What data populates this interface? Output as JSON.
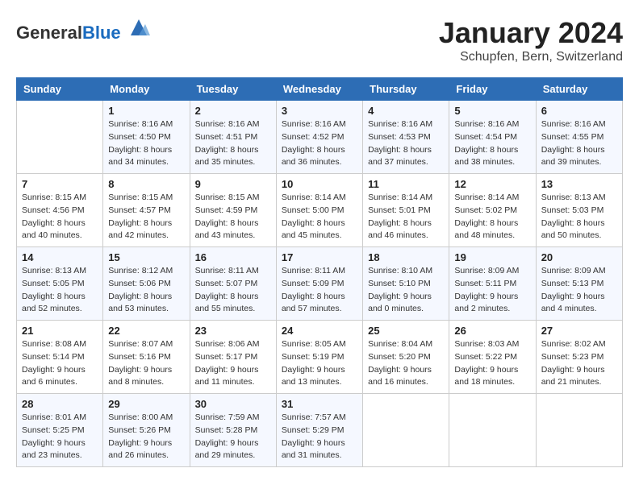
{
  "header": {
    "logo_general": "General",
    "logo_blue": "Blue",
    "month_title": "January 2024",
    "location": "Schupfen, Bern, Switzerland"
  },
  "days_of_week": [
    "Sunday",
    "Monday",
    "Tuesday",
    "Wednesday",
    "Thursday",
    "Friday",
    "Saturday"
  ],
  "weeks": [
    [
      {
        "day": "",
        "sunrise": "",
        "sunset": "",
        "daylight": ""
      },
      {
        "day": "1",
        "sunrise": "Sunrise: 8:16 AM",
        "sunset": "Sunset: 4:50 PM",
        "daylight": "Daylight: 8 hours and 34 minutes."
      },
      {
        "day": "2",
        "sunrise": "Sunrise: 8:16 AM",
        "sunset": "Sunset: 4:51 PM",
        "daylight": "Daylight: 8 hours and 35 minutes."
      },
      {
        "day": "3",
        "sunrise": "Sunrise: 8:16 AM",
        "sunset": "Sunset: 4:52 PM",
        "daylight": "Daylight: 8 hours and 36 minutes."
      },
      {
        "day": "4",
        "sunrise": "Sunrise: 8:16 AM",
        "sunset": "Sunset: 4:53 PM",
        "daylight": "Daylight: 8 hours and 37 minutes."
      },
      {
        "day": "5",
        "sunrise": "Sunrise: 8:16 AM",
        "sunset": "Sunset: 4:54 PM",
        "daylight": "Daylight: 8 hours and 38 minutes."
      },
      {
        "day": "6",
        "sunrise": "Sunrise: 8:16 AM",
        "sunset": "Sunset: 4:55 PM",
        "daylight": "Daylight: 8 hours and 39 minutes."
      }
    ],
    [
      {
        "day": "7",
        "sunrise": "Sunrise: 8:15 AM",
        "sunset": "Sunset: 4:56 PM",
        "daylight": "Daylight: 8 hours and 40 minutes."
      },
      {
        "day": "8",
        "sunrise": "Sunrise: 8:15 AM",
        "sunset": "Sunset: 4:57 PM",
        "daylight": "Daylight: 8 hours and 42 minutes."
      },
      {
        "day": "9",
        "sunrise": "Sunrise: 8:15 AM",
        "sunset": "Sunset: 4:59 PM",
        "daylight": "Daylight: 8 hours and 43 minutes."
      },
      {
        "day": "10",
        "sunrise": "Sunrise: 8:14 AM",
        "sunset": "Sunset: 5:00 PM",
        "daylight": "Daylight: 8 hours and 45 minutes."
      },
      {
        "day": "11",
        "sunrise": "Sunrise: 8:14 AM",
        "sunset": "Sunset: 5:01 PM",
        "daylight": "Daylight: 8 hours and 46 minutes."
      },
      {
        "day": "12",
        "sunrise": "Sunrise: 8:14 AM",
        "sunset": "Sunset: 5:02 PM",
        "daylight": "Daylight: 8 hours and 48 minutes."
      },
      {
        "day": "13",
        "sunrise": "Sunrise: 8:13 AM",
        "sunset": "Sunset: 5:03 PM",
        "daylight": "Daylight: 8 hours and 50 minutes."
      }
    ],
    [
      {
        "day": "14",
        "sunrise": "Sunrise: 8:13 AM",
        "sunset": "Sunset: 5:05 PM",
        "daylight": "Daylight: 8 hours and 52 minutes."
      },
      {
        "day": "15",
        "sunrise": "Sunrise: 8:12 AM",
        "sunset": "Sunset: 5:06 PM",
        "daylight": "Daylight: 8 hours and 53 minutes."
      },
      {
        "day": "16",
        "sunrise": "Sunrise: 8:11 AM",
        "sunset": "Sunset: 5:07 PM",
        "daylight": "Daylight: 8 hours and 55 minutes."
      },
      {
        "day": "17",
        "sunrise": "Sunrise: 8:11 AM",
        "sunset": "Sunset: 5:09 PM",
        "daylight": "Daylight: 8 hours and 57 minutes."
      },
      {
        "day": "18",
        "sunrise": "Sunrise: 8:10 AM",
        "sunset": "Sunset: 5:10 PM",
        "daylight": "Daylight: 9 hours and 0 minutes."
      },
      {
        "day": "19",
        "sunrise": "Sunrise: 8:09 AM",
        "sunset": "Sunset: 5:11 PM",
        "daylight": "Daylight: 9 hours and 2 minutes."
      },
      {
        "day": "20",
        "sunrise": "Sunrise: 8:09 AM",
        "sunset": "Sunset: 5:13 PM",
        "daylight": "Daylight: 9 hours and 4 minutes."
      }
    ],
    [
      {
        "day": "21",
        "sunrise": "Sunrise: 8:08 AM",
        "sunset": "Sunset: 5:14 PM",
        "daylight": "Daylight: 9 hours and 6 minutes."
      },
      {
        "day": "22",
        "sunrise": "Sunrise: 8:07 AM",
        "sunset": "Sunset: 5:16 PM",
        "daylight": "Daylight: 9 hours and 8 minutes."
      },
      {
        "day": "23",
        "sunrise": "Sunrise: 8:06 AM",
        "sunset": "Sunset: 5:17 PM",
        "daylight": "Daylight: 9 hours and 11 minutes."
      },
      {
        "day": "24",
        "sunrise": "Sunrise: 8:05 AM",
        "sunset": "Sunset: 5:19 PM",
        "daylight": "Daylight: 9 hours and 13 minutes."
      },
      {
        "day": "25",
        "sunrise": "Sunrise: 8:04 AM",
        "sunset": "Sunset: 5:20 PM",
        "daylight": "Daylight: 9 hours and 16 minutes."
      },
      {
        "day": "26",
        "sunrise": "Sunrise: 8:03 AM",
        "sunset": "Sunset: 5:22 PM",
        "daylight": "Daylight: 9 hours and 18 minutes."
      },
      {
        "day": "27",
        "sunrise": "Sunrise: 8:02 AM",
        "sunset": "Sunset: 5:23 PM",
        "daylight": "Daylight: 9 hours and 21 minutes."
      }
    ],
    [
      {
        "day": "28",
        "sunrise": "Sunrise: 8:01 AM",
        "sunset": "Sunset: 5:25 PM",
        "daylight": "Daylight: 9 hours and 23 minutes."
      },
      {
        "day": "29",
        "sunrise": "Sunrise: 8:00 AM",
        "sunset": "Sunset: 5:26 PM",
        "daylight": "Daylight: 9 hours and 26 minutes."
      },
      {
        "day": "30",
        "sunrise": "Sunrise: 7:59 AM",
        "sunset": "Sunset: 5:28 PM",
        "daylight": "Daylight: 9 hours and 29 minutes."
      },
      {
        "day": "31",
        "sunrise": "Sunrise: 7:57 AM",
        "sunset": "Sunset: 5:29 PM",
        "daylight": "Daylight: 9 hours and 31 minutes."
      },
      {
        "day": "",
        "sunrise": "",
        "sunset": "",
        "daylight": ""
      },
      {
        "day": "",
        "sunrise": "",
        "sunset": "",
        "daylight": ""
      },
      {
        "day": "",
        "sunrise": "",
        "sunset": "",
        "daylight": ""
      }
    ]
  ]
}
